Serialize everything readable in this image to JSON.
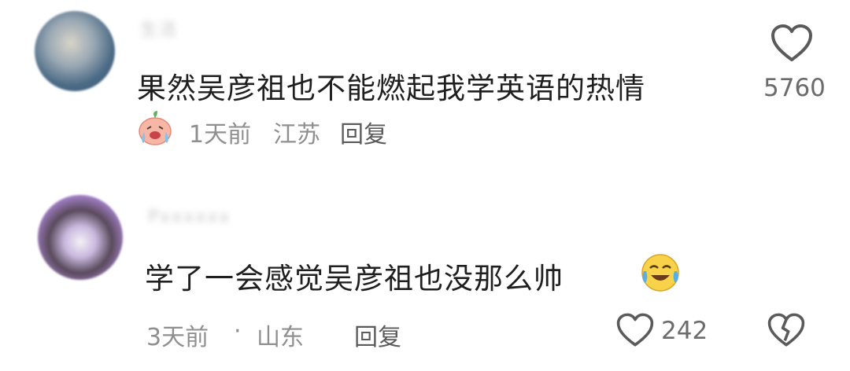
{
  "comments": [
    {
      "username": "生活",
      "text": "果然吴彦祖也不能燃起我学英语的热情",
      "time": "1天前",
      "location": "江苏",
      "reply_label": "回复",
      "likes": "5760"
    },
    {
      "username": "Pxxxxxx",
      "text": "学了一会感觉吴彦祖也没那么帅",
      "time": "3天前",
      "separator": "·",
      "location": "山东",
      "reply_label": "回复",
      "likes": "242"
    }
  ],
  "icons": {
    "like": "heart-outline-icon",
    "dislike": "broken-heart-icon",
    "badge": "peach-crying-emoji-icon",
    "inline_emoji": "tears-of-joy-emoji-icon"
  },
  "colors": {
    "text": "#1f1f1f",
    "meta": "#8f8f8f",
    "icon": "#5a5a5a"
  }
}
